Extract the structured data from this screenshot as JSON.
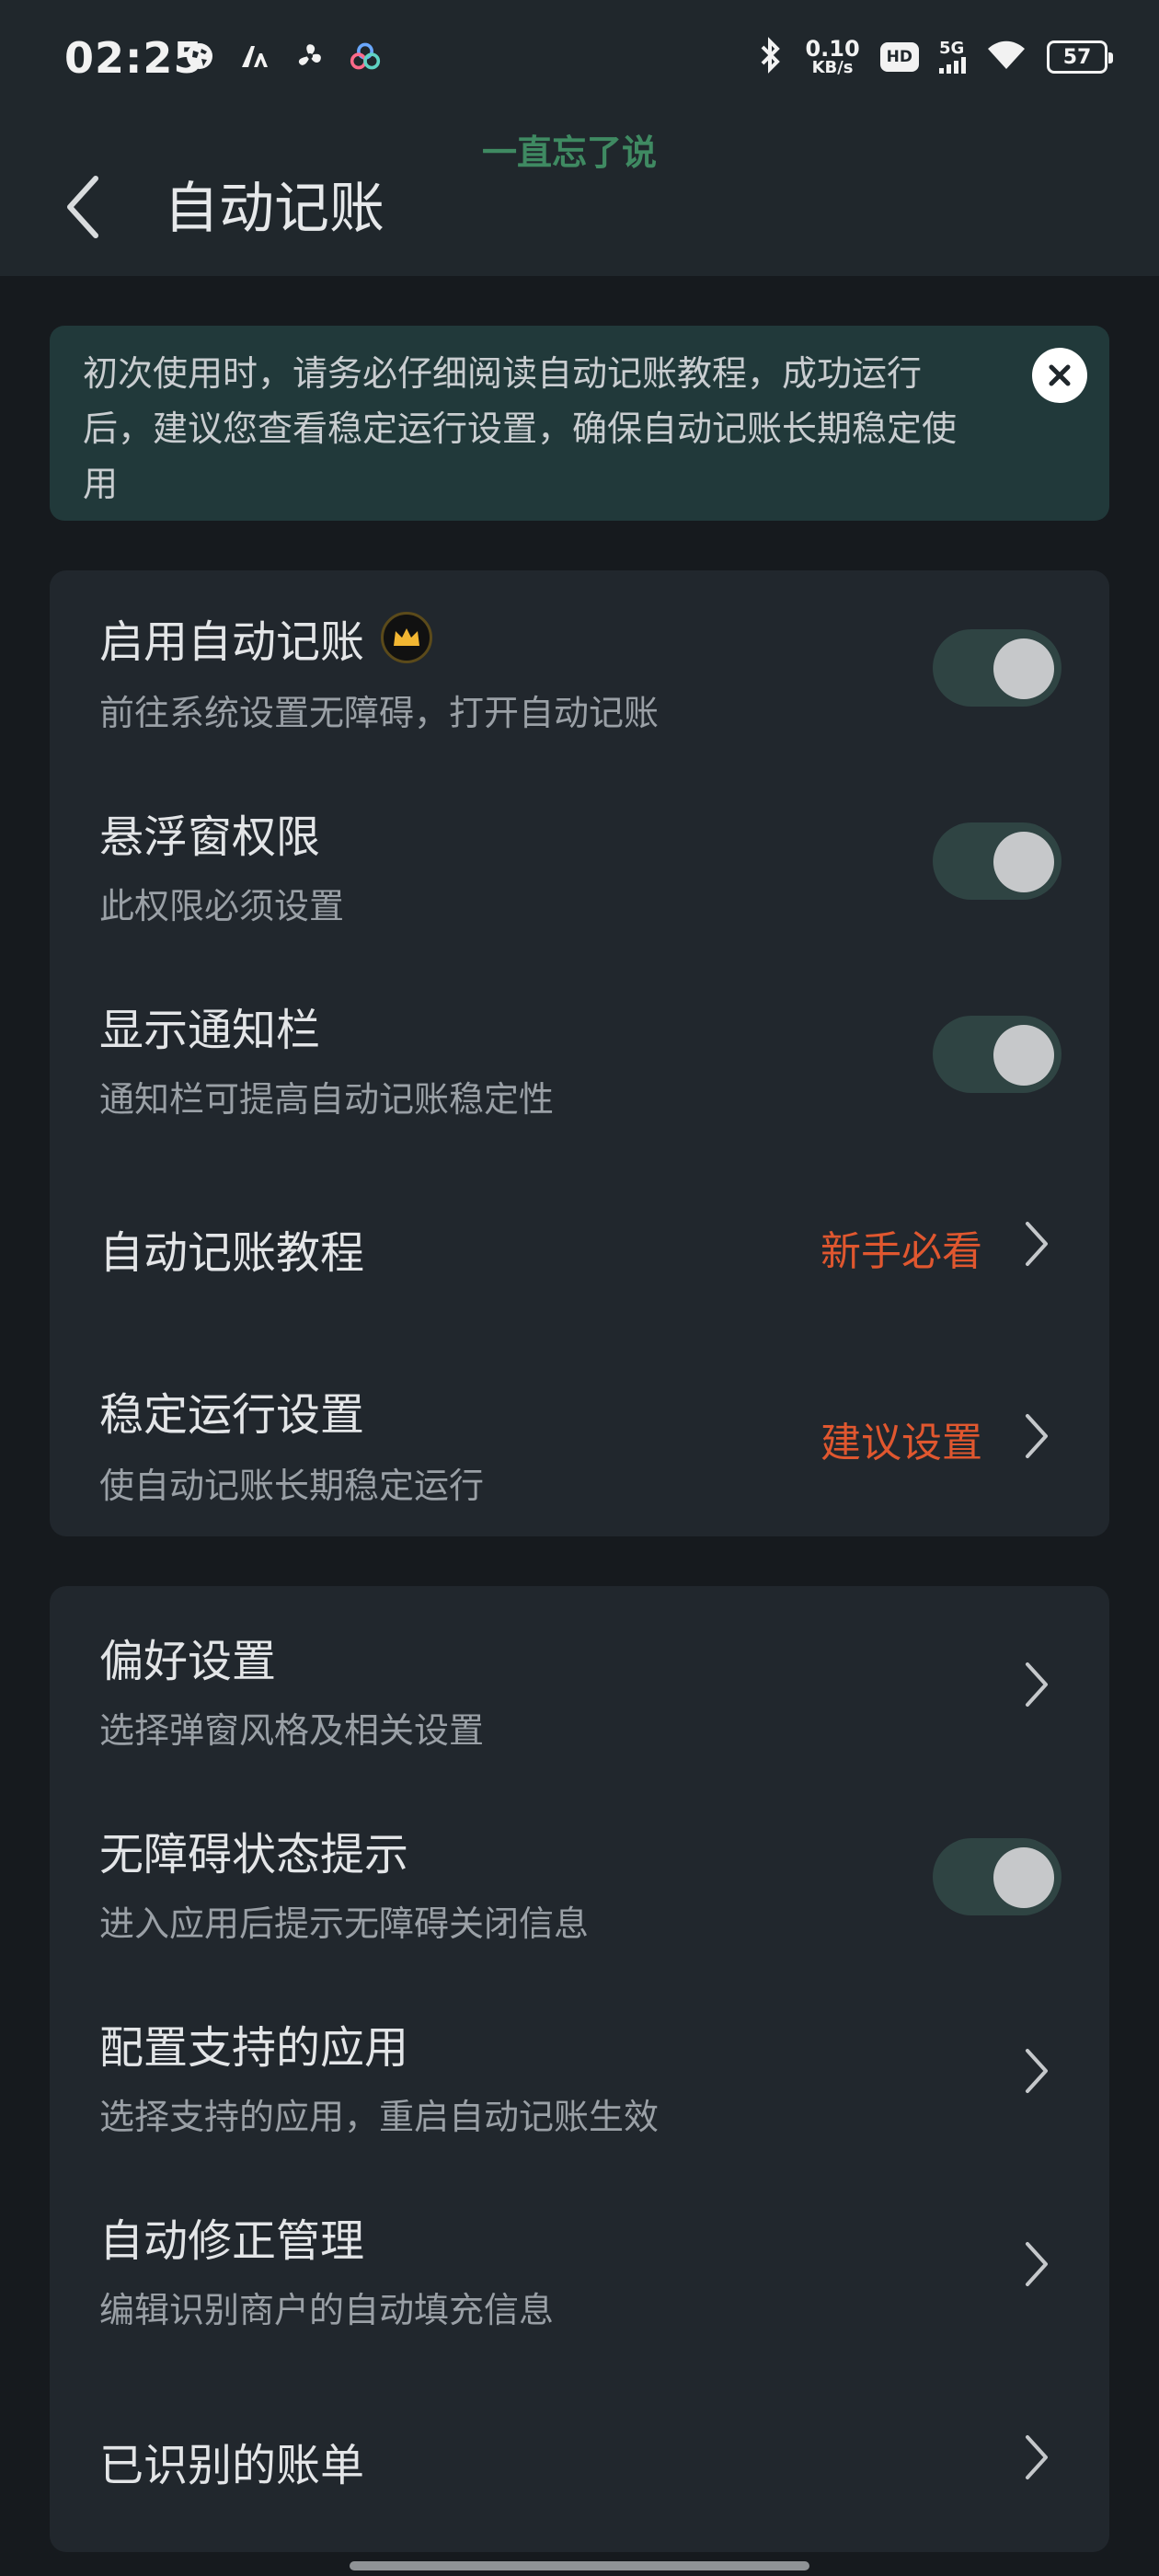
{
  "status_bar": {
    "time": "02:25",
    "net_speed_value": "0.10",
    "net_speed_unit": "KB/s",
    "hd_label": "HD",
    "signal_label": "5G",
    "battery": "57",
    "left_icons": [
      "globe-icon",
      "font-a-icon",
      "pinwheel-icon",
      "loop-icon"
    ]
  },
  "header": {
    "title": "自动记账",
    "watermark": "一直忘了说"
  },
  "notice": {
    "text": "初次使用时，请务必仔细阅读自动记账教程，成功运行后，建议您查看稳定运行设置，确保自动记账长期稳定使用"
  },
  "section1": {
    "enable": {
      "title": "启用自动记账",
      "subtitle": "前往系统设置无障碍，打开自动记账",
      "on": true
    },
    "float": {
      "title": "悬浮窗权限",
      "subtitle": "此权限必须设置",
      "on": true
    },
    "notify": {
      "title": "显示通知栏",
      "subtitle": "通知栏可提高自动记账稳定性",
      "on": true
    },
    "tutorial": {
      "title": "自动记账教程",
      "hint": "新手必看"
    },
    "stable": {
      "title": "稳定运行设置",
      "subtitle": "使自动记账长期稳定运行",
      "hint": "建议设置"
    }
  },
  "section2": {
    "prefs": {
      "title": "偏好设置",
      "subtitle": "选择弹窗风格及相关设置"
    },
    "a11y": {
      "title": "无障碍状态提示",
      "subtitle": "进入应用后提示无障碍关闭信息",
      "on": true
    },
    "apps": {
      "title": "配置支持的应用",
      "subtitle": "选择支持的应用，重启自动记账生效"
    },
    "correct": {
      "title": "自动修正管理",
      "subtitle": "编辑识别商户的自动填充信息"
    },
    "bills": {
      "title": "已识别的账单"
    }
  },
  "colors": {
    "background": "#161a1e",
    "card": "#21272d",
    "notice_bg": "#21393a",
    "accent_hint": "#e0572f",
    "toggle_track": "#2f4443",
    "watermark": "#3f8a62"
  }
}
